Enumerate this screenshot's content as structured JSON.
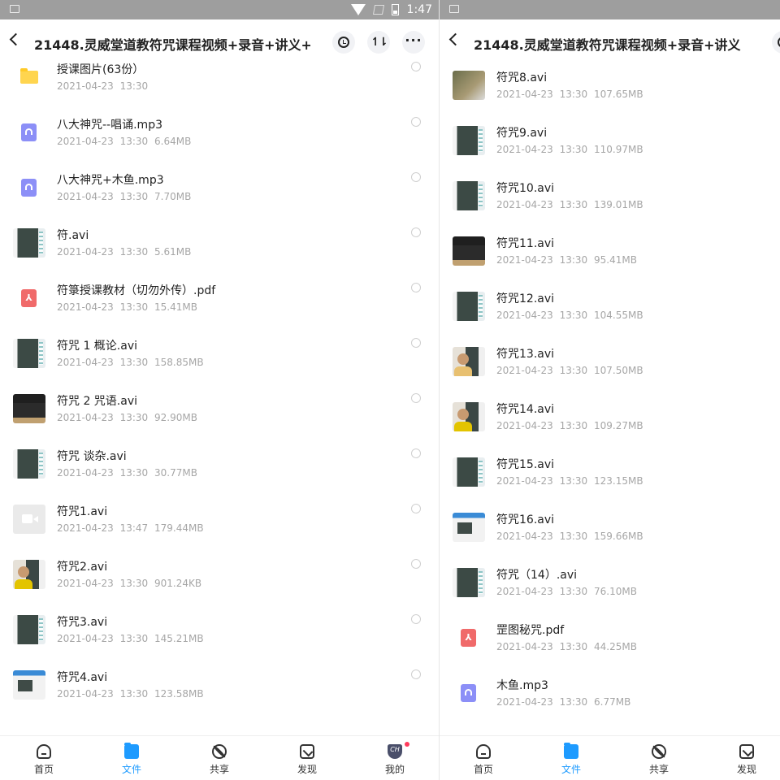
{
  "statusbar": {
    "time": "1:47"
  },
  "left": {
    "title": "21448.灵威堂道教符咒课程视频+录音+讲义+...",
    "files": [
      {
        "name": "授课图片(63份）",
        "date": "2021-04-23",
        "time": "13:30",
        "size": "",
        "icon": "folder-icon"
      },
      {
        "name": "八大神咒--唱诵.mp3",
        "date": "2021-04-23",
        "time": "13:30",
        "size": "6.64MB",
        "icon": "audio-file-icon"
      },
      {
        "name": "八大神咒+木鱼.mp3",
        "date": "2021-04-23",
        "time": "13:30",
        "size": "7.70MB",
        "icon": "audio-file-icon"
      },
      {
        "name": "符.avi",
        "date": "2021-04-23",
        "time": "13:30",
        "size": "5.61MB",
        "icon": "video-thumbnail"
      },
      {
        "name": "符箓授课教材（切勿外传）.pdf",
        "date": "2021-04-23",
        "time": "13:30",
        "size": "15.41MB",
        "icon": "pdf-file-icon"
      },
      {
        "name": "符咒 1 概论.avi",
        "date": "2021-04-23",
        "time": "13:30",
        "size": "158.85MB",
        "icon": "video-thumbnail"
      },
      {
        "name": "符咒 2 咒语.avi",
        "date": "2021-04-23",
        "time": "13:30",
        "size": "92.90MB",
        "icon": "video-thumbnail"
      },
      {
        "name": "符咒 谈杂.avi",
        "date": "2021-04-23",
        "time": "13:30",
        "size": "30.77MB",
        "icon": "video-thumbnail"
      },
      {
        "name": "符咒1.avi",
        "date": "2021-04-23",
        "time": "13:47",
        "size": "179.44MB",
        "icon": "video-file-icon"
      },
      {
        "name": "符咒2.avi",
        "date": "2021-04-23",
        "time": "13:30",
        "size": "901.24KB",
        "icon": "video-thumbnail"
      },
      {
        "name": "符咒3.avi",
        "date": "2021-04-23",
        "time": "13:30",
        "size": "145.21MB",
        "icon": "video-thumbnail"
      },
      {
        "name": "符咒4.avi",
        "date": "2021-04-23",
        "time": "13:30",
        "size": "123.58MB",
        "icon": "video-thumbnail"
      }
    ]
  },
  "right": {
    "title": "21448.灵威堂道教符咒课程视频+录音+讲义+...",
    "files": [
      {
        "name": "符咒8.avi",
        "date": "2021-04-23",
        "time": "13:30",
        "size": "107.65MB",
        "icon": "video-thumbnail"
      },
      {
        "name": "符咒9.avi",
        "date": "2021-04-23",
        "time": "13:30",
        "size": "110.97MB",
        "icon": "video-thumbnail"
      },
      {
        "name": "符咒10.avi",
        "date": "2021-04-23",
        "time": "13:30",
        "size": "139.01MB",
        "icon": "video-thumbnail"
      },
      {
        "name": "符咒11.avi",
        "date": "2021-04-23",
        "time": "13:30",
        "size": "95.41MB",
        "icon": "video-thumbnail"
      },
      {
        "name": "符咒12.avi",
        "date": "2021-04-23",
        "time": "13:30",
        "size": "104.55MB",
        "icon": "video-thumbnail"
      },
      {
        "name": "符咒13.avi",
        "date": "2021-04-23",
        "time": "13:30",
        "size": "107.50MB",
        "icon": "video-thumbnail"
      },
      {
        "name": "符咒14.avi",
        "date": "2021-04-23",
        "time": "13:30",
        "size": "109.27MB",
        "icon": "video-thumbnail"
      },
      {
        "name": "符咒15.avi",
        "date": "2021-04-23",
        "time": "13:30",
        "size": "123.15MB",
        "icon": "video-thumbnail"
      },
      {
        "name": "符咒16.avi",
        "date": "2021-04-23",
        "time": "13:30",
        "size": "159.66MB",
        "icon": "video-thumbnail"
      },
      {
        "name": "符咒（14）.avi",
        "date": "2021-04-23",
        "time": "13:30",
        "size": "76.10MB",
        "icon": "video-thumbnail"
      },
      {
        "name": "罡图秘咒.pdf",
        "date": "2021-04-23",
        "time": "13:30",
        "size": "44.25MB",
        "icon": "pdf-file-icon"
      },
      {
        "name": "木鱼.mp3",
        "date": "2021-04-23",
        "time": "13:30",
        "size": "6.77MB",
        "icon": "audio-file-icon"
      }
    ]
  },
  "nav": {
    "home": "首页",
    "files": "文件",
    "share": "共享",
    "discover": "发现",
    "mine": "我的",
    "mine_avatar": "CH"
  },
  "colors": {
    "accent": "#1e9bff",
    "badge": "#ff3b5c"
  }
}
